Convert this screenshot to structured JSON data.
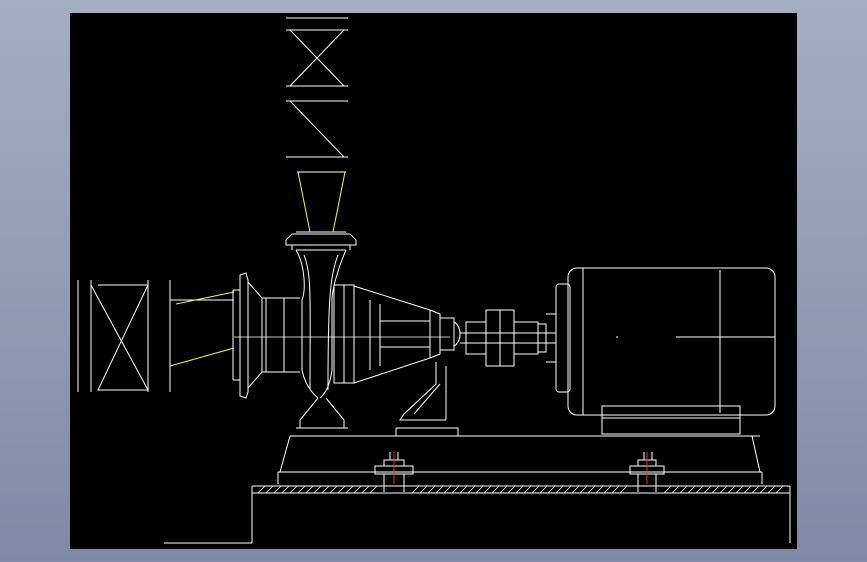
{
  "colors": {
    "background_gradient_top": "#a3aec4",
    "background_gradient_bottom": "#7f8ba6",
    "canvas": "#000000",
    "line": "#ffffff",
    "highlight": "#f2f25a",
    "anchor_bolt": "#e03030"
  }
}
